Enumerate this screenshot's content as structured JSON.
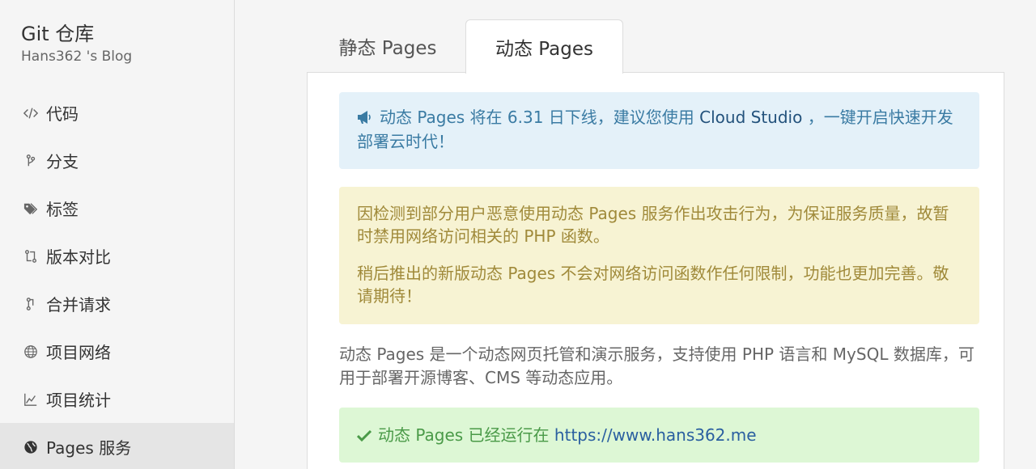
{
  "sidebar": {
    "title": "Git 仓库",
    "subtitle": "Hans362 's Blog",
    "items": [
      {
        "label": "代码",
        "icon": "code-icon"
      },
      {
        "label": "分支",
        "icon": "branch-icon"
      },
      {
        "label": "标签",
        "icon": "tags-icon"
      },
      {
        "label": "版本对比",
        "icon": "compare-icon"
      },
      {
        "label": "合并请求",
        "icon": "merge-request-icon"
      },
      {
        "label": "项目网络",
        "icon": "globe-outline-icon"
      },
      {
        "label": "项目统计",
        "icon": "chart-icon"
      },
      {
        "label": "Pages 服务",
        "icon": "globe-filled-icon"
      }
    ],
    "active_index": 7
  },
  "tabs": [
    {
      "label": "静态 Pages"
    },
    {
      "label": "动态 Pages"
    }
  ],
  "active_tab": 1,
  "info": {
    "icon": "megaphone-icon",
    "text_before": "动态 Pages 将在 6.31 日下线，建议您使用 ",
    "link": "Cloud Studio",
    "text_after": " ，一键开启快速开发部署云时代！"
  },
  "warning": {
    "paragraph1": "因检测到部分用户恶意使用动态 Pages 服务作出攻击行为，为保证服务质量，故暂时禁用网络访问相关的 PHP 函数。",
    "paragraph2": "稍后推出的新版动态 Pages 不会对网络访问函数作任何限制，功能也更加完善。敬请期待！"
  },
  "description": "动态 Pages 是一个动态网页托管和演示服务，支持使用 PHP 语言和 MySQL 数据库，可用于部署开源博客、CMS 等动态应用。",
  "status": {
    "icon": "check-icon",
    "text": "动态 Pages 已经运行在 ",
    "link": "https://www.hans362.me"
  },
  "colors": {
    "info_bg": "#e4f1f9",
    "warn_bg": "#f7f3d3",
    "success_bg": "#ddf7d5",
    "active_nav_bg": "#e5e5e5"
  }
}
